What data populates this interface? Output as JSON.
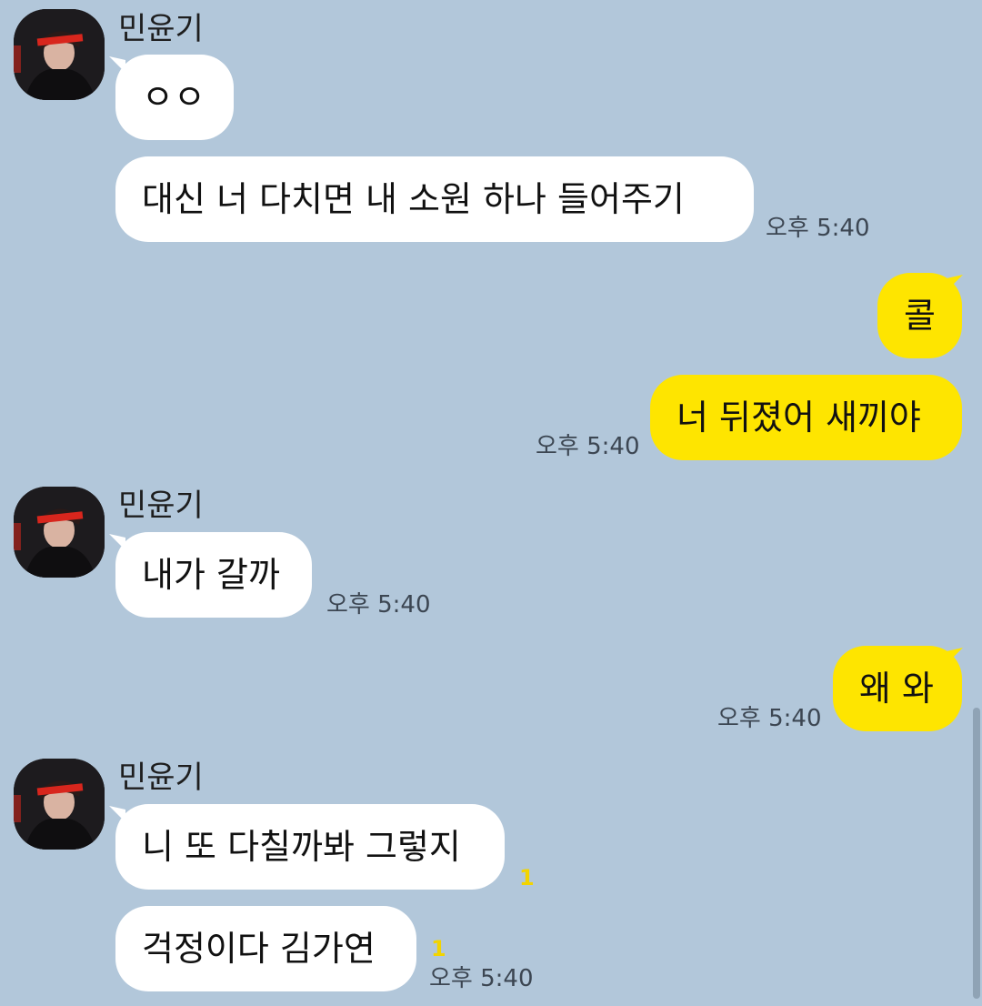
{
  "contact": {
    "name": "민윤기",
    "avatar_icon": "profile-photo-icon"
  },
  "colors": {
    "background": "#b2c7da",
    "incoming_bubble": "#ffffff",
    "outgoing_bubble": "#fee500",
    "unread": "#f2d400"
  },
  "messages": [
    {
      "sender": "민윤기",
      "text": "ㅇㅇ",
      "time": ""
    },
    {
      "sender": "민윤기",
      "text": "대신 너 다치면 내 소원 하나 들어주기",
      "time": "오후 5:40"
    },
    {
      "sender": "me",
      "text": "콜",
      "time": ""
    },
    {
      "sender": "me",
      "text": "너 뒤졌어 새끼야",
      "time": "오후 5:40"
    },
    {
      "sender": "민윤기",
      "text": "내가 갈까",
      "time": "오후 5:40"
    },
    {
      "sender": "me",
      "text": "왜 와",
      "time": "오후 5:40"
    },
    {
      "sender": "민윤기",
      "text": "니 또 다칠까봐 그렇지",
      "time": "",
      "unread": "1"
    },
    {
      "sender": "민윤기",
      "text": "걱정이다 김가연",
      "time": "오후 5:40",
      "unread": "1"
    }
  ]
}
